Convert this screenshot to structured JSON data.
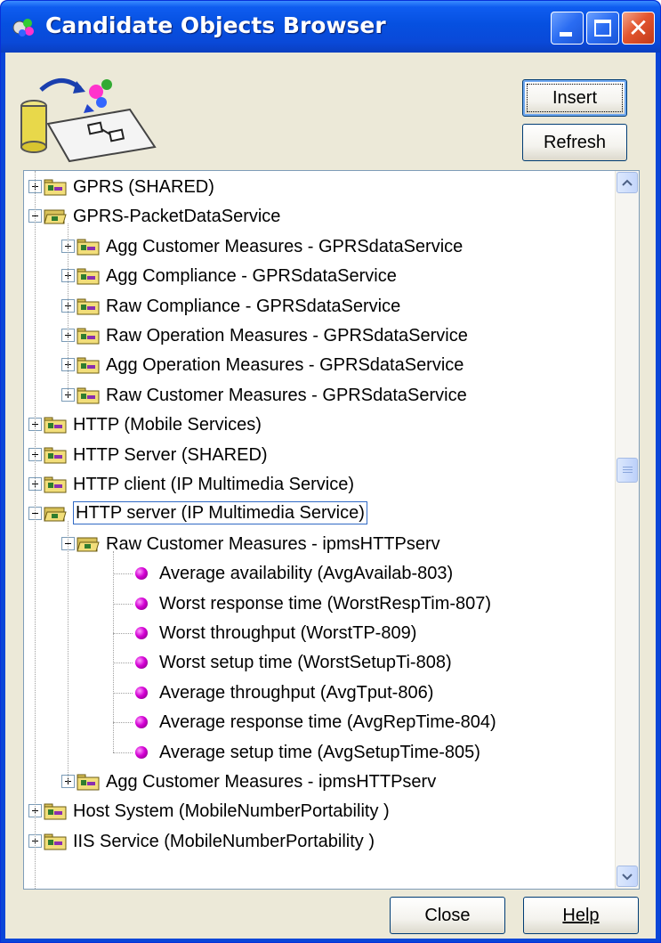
{
  "window": {
    "title": "Candidate Objects Browser"
  },
  "title_buttons": {
    "minimize": "minimize-button",
    "maximize": "maximize-button",
    "close": "close-button"
  },
  "buttons": {
    "insert": "Insert",
    "refresh": "Refresh",
    "close": "Close",
    "help": "Help"
  },
  "tree": {
    "selected": "HTTP server (IP Multimedia Service)",
    "rows": [
      {
        "label": "GPRS (SHARED)",
        "level": 0,
        "state": "collapsed",
        "icon": "folder-icon"
      },
      {
        "label": "GPRS-PacketDataService",
        "level": 0,
        "state": "expanded",
        "icon": "open-folder-icon"
      },
      {
        "label": "Agg Customer Measures - GPRSdataService",
        "level": 1,
        "state": "collapsed",
        "icon": "folder-icon"
      },
      {
        "label": "Agg Compliance  - GPRSdataService",
        "level": 1,
        "state": "collapsed",
        "icon": "folder-icon"
      },
      {
        "label": "Raw Compliance - GPRSdataService",
        "level": 1,
        "state": "collapsed",
        "icon": "folder-icon"
      },
      {
        "label": "Raw Operation Measures - GPRSdataService",
        "level": 1,
        "state": "collapsed",
        "icon": "folder-icon"
      },
      {
        "label": "Agg Operation Measures - GPRSdataService",
        "level": 1,
        "state": "collapsed",
        "icon": "folder-icon"
      },
      {
        "label": "Raw Customer Measures - GPRSdataService",
        "level": 1,
        "state": "collapsed",
        "icon": "folder-icon"
      },
      {
        "label": "HTTP (Mobile Services)",
        "level": 0,
        "state": "collapsed",
        "icon": "folder-icon"
      },
      {
        "label": "HTTP Server (SHARED)",
        "level": 0,
        "state": "collapsed",
        "icon": "folder-icon"
      },
      {
        "label": "HTTP client (IP Multimedia Service)",
        "level": 0,
        "state": "collapsed",
        "icon": "folder-icon"
      },
      {
        "label": "HTTP server (IP Multimedia Service)",
        "level": 0,
        "state": "expanded",
        "icon": "open-folder-icon"
      },
      {
        "label": "Raw Customer Measures - ipmsHTTPserv",
        "level": 1,
        "state": "expanded",
        "icon": "open-folder-icon"
      },
      {
        "label": "Average availability (AvgAvailab-803)",
        "level": 2,
        "state": "leaf",
        "icon": "measure-bullet-icon"
      },
      {
        "label": "Worst response time (WorstRespTim-807)",
        "level": 2,
        "state": "leaf",
        "icon": "measure-bullet-icon"
      },
      {
        "label": "Worst throughput (WorstTP-809)",
        "level": 2,
        "state": "leaf",
        "icon": "measure-bullet-icon"
      },
      {
        "label": "Worst setup time (WorstSetupTi-808)",
        "level": 2,
        "state": "leaf",
        "icon": "measure-bullet-icon"
      },
      {
        "label": "Average throughput (AvgTput-806)",
        "level": 2,
        "state": "leaf",
        "icon": "measure-bullet-icon"
      },
      {
        "label": "Average response time (AvgRepTime-804)",
        "level": 2,
        "state": "leaf",
        "icon": "measure-bullet-icon"
      },
      {
        "label": "Average setup time (AvgSetupTime-805)",
        "level": 2,
        "state": "leaf",
        "icon": "measure-bullet-icon"
      },
      {
        "label": "Agg Customer Measures - ipmsHTTPserv",
        "level": 1,
        "state": "collapsed",
        "icon": "folder-icon"
      },
      {
        "label": "Host System (MobileNumberPortability )",
        "level": 0,
        "state": "collapsed",
        "icon": "folder-icon"
      },
      {
        "label": "IIS Service (MobileNumberPortability )",
        "level": 0,
        "state": "collapsed",
        "icon": "folder-icon"
      }
    ]
  },
  "colors": {
    "title_bar": "#0a49d8",
    "dialog_bg": "#ece9d8",
    "selection_border": "#316ac5",
    "bullet": "#d400d4"
  }
}
